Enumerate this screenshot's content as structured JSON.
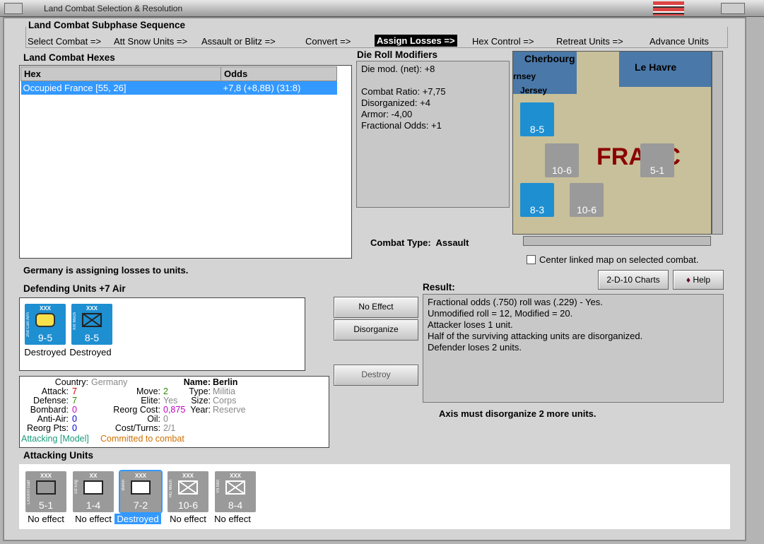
{
  "window": {
    "title": "Land Combat Selection & Resolution"
  },
  "sequence": {
    "title": "Land Combat Subphase Sequence",
    "steps": [
      "Select Combat =>",
      "Att Snow Units =>",
      "Assault or Blitz =>",
      "Convert =>",
      "Assign Losses =>",
      "Hex Control =>",
      "Retreat Units =>",
      "Advance Units"
    ],
    "active": "Assign Losses =>"
  },
  "hexes": {
    "title": "Land Combat Hexes",
    "col_hex": "Hex",
    "col_odds": "Odds",
    "rows": [
      {
        "hex": "Occupied France [55, 26]",
        "odds": "+7,8 (+8,8B) (31:8)"
      }
    ]
  },
  "modifiers": {
    "title": "Die Roll Modifiers",
    "lines": [
      "Die mod. (net): +8",
      "",
      "Combat Ratio: +7,75",
      "Disorganized: +4",
      "Armor: -4,00",
      "Fractional Odds: +1"
    ]
  },
  "combat_type": {
    "label": "Combat Type:",
    "value": "Assault"
  },
  "map": {
    "labels": [
      "Cherbourg",
      "Le Havre",
      "rnsey",
      "Jersey",
      "FRANC"
    ],
    "counters": [
      "8-5",
      "10-6",
      "5-1",
      "8-3",
      "10-6"
    ],
    "center_label": "Center linked map on selected combat."
  },
  "status": "Germany is assigning losses to units.",
  "defending": {
    "title": "Defending Units +7 Air",
    "units": [
      {
        "size": "XXX",
        "str": "9-5",
        "side": "2nd Can Arm",
        "status": "Destroyed"
      },
      {
        "size": "XXX",
        "str": "8-5",
        "side": "XIII Mech",
        "status": "Destroyed"
      }
    ]
  },
  "buttons": {
    "charts": "2-D-10 Charts",
    "help": "Help",
    "no_effect": "No Effect",
    "disorganize": "Disorganize",
    "destroy": "Destroy"
  },
  "result": {
    "title": "Result:",
    "lines": [
      "Fractional odds (.750) roll was (.229)  - Yes.",
      "Unmodified roll = 12, Modified = 20.",
      "Attacker loses 1 unit.",
      "Half of the surviving attacking units are disorganized.",
      "Defender loses 2 units."
    ],
    "footer": "Axis must disorganize 2 more units."
  },
  "info": {
    "country_k": "Country:",
    "country_v": "Germany",
    "attack_k": "Attack:",
    "attack_v": "7",
    "defense_k": "Defense:",
    "defense_v": "7",
    "bombard_k": "Bombard:",
    "bombard_v": "0",
    "antiair_k": "Anti-Air:",
    "antiair_v": "0",
    "reorg_k": "Reorg Pts:",
    "reorg_v": "0",
    "move_k": "Move:",
    "move_v": "2",
    "elite_k": "Elite:",
    "elite_v": "Yes",
    "reorgcost_k": "Reorg Cost:",
    "reorgcost_v": "0,875",
    "oil_k": "Oil:",
    "oil_v": "0",
    "cost_k": "Cost/Turns:",
    "cost_v": "2/1",
    "name_k": "Name:",
    "name_v": "Berlin",
    "type_k": "Type:",
    "type_v": "Militia",
    "size_k": "Size:",
    "size_v": "Corps",
    "year_k": "Year:",
    "year_v": "Reserve",
    "attacking_model": "Attacking [Model]",
    "committed": "Committed to combat"
  },
  "attacking": {
    "title": "Attacking Units",
    "units": [
      {
        "size": "XXX",
        "str": "5-1",
        "side": "LXXXVI Garr",
        "status": "No effect"
      },
      {
        "size": "XX",
        "str": "1-4",
        "side": "1st Eng",
        "status": "No effect"
      },
      {
        "size": "XXX",
        "str": "7-2",
        "side": "Berlin",
        "status": "Destroyed"
      },
      {
        "size": "XXX",
        "str": "10-6",
        "side": "HG Mech",
        "status": "No effect"
      },
      {
        "size": "XXX",
        "str": "8-4",
        "side": "VII Mot",
        "status": "No effect"
      }
    ]
  }
}
